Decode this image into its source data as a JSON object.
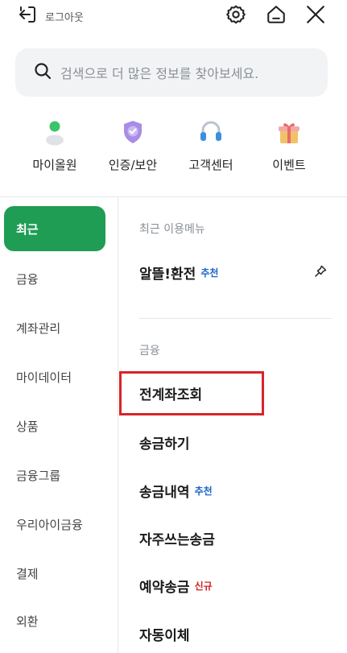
{
  "topbar": {
    "logout_label": "로그아웃",
    "icons": [
      "logout-icon",
      "gear-icon",
      "home-icon",
      "close-icon"
    ]
  },
  "search": {
    "placeholder": "검색으로 더 많은 정보를 찾아보세요."
  },
  "quick_menu": [
    {
      "label": "마이올원",
      "icon": "person-icon"
    },
    {
      "label": "인증/보안",
      "icon": "shield-check-icon"
    },
    {
      "label": "고객센터",
      "icon": "headset-icon"
    },
    {
      "label": "이벤트",
      "icon": "gift-icon"
    }
  ],
  "sidebar": {
    "items": [
      {
        "label": "최근",
        "active": true
      },
      {
        "label": "금융"
      },
      {
        "label": "계좌관리"
      },
      {
        "label": "마이데이터"
      },
      {
        "label": "상품"
      },
      {
        "label": "금융그룹"
      },
      {
        "label": "우리아이금융"
      },
      {
        "label": "결제"
      },
      {
        "label": "외환"
      }
    ]
  },
  "content": {
    "recent_label": "최근 이용메뉴",
    "recent_items": [
      {
        "label": "알뜰!환전",
        "tag": "추천"
      }
    ],
    "finance_label": "금융",
    "finance_items": [
      {
        "label": "전계좌조회"
      },
      {
        "label": "송금하기"
      },
      {
        "label": "송금내역",
        "tag": "추천"
      },
      {
        "label": "자주쓰는송금"
      },
      {
        "label": "예약송금",
        "tag": "신규"
      },
      {
        "label": "자동이체"
      }
    ]
  },
  "colors": {
    "accent_green": "#1f9d55",
    "recommend_blue": "#1c64c8",
    "new_red": "#d32121",
    "highlight_red": "#d8242a"
  }
}
